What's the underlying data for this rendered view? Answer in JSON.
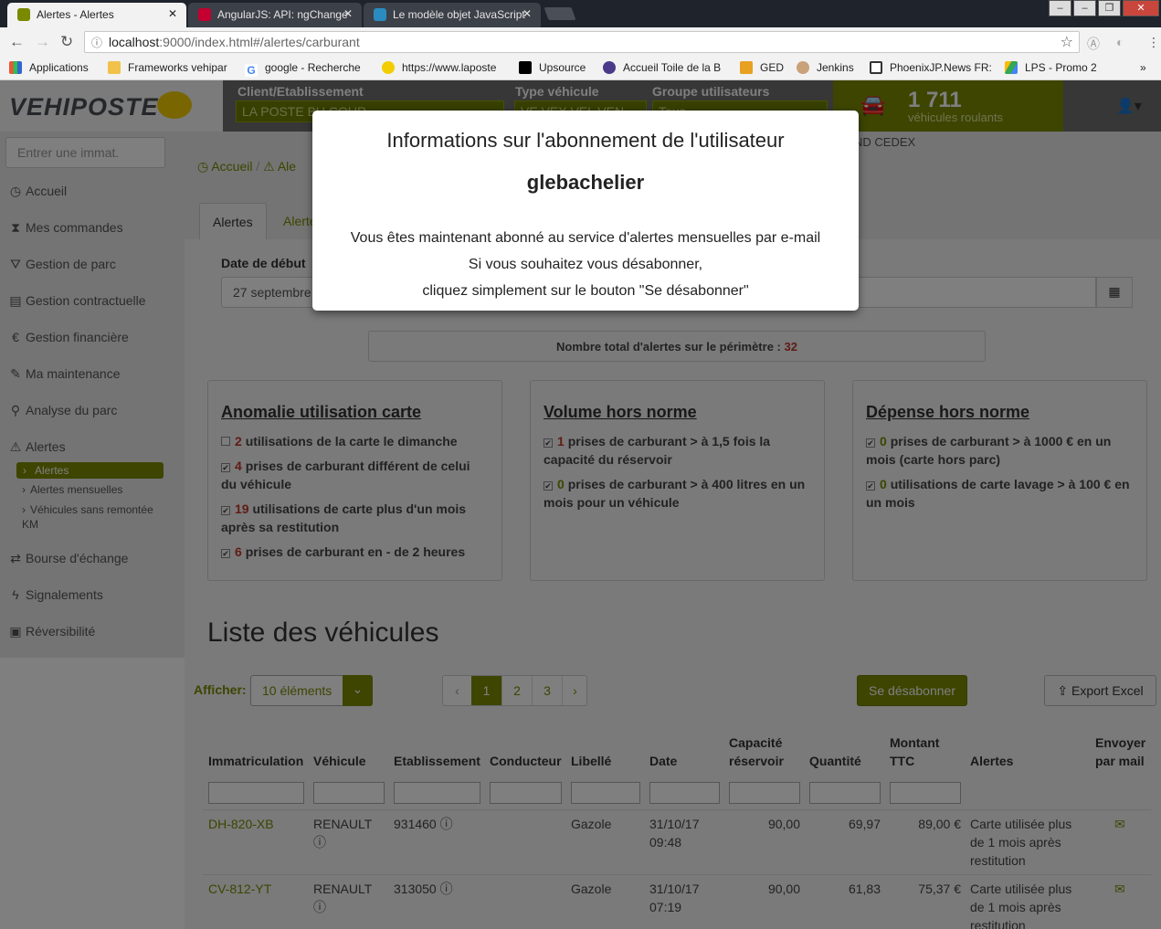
{
  "browser": {
    "tabs": [
      {
        "title": "Alertes - Alertes",
        "close": "✕"
      },
      {
        "title": "AngularJS: API: ngChange",
        "close": "✕"
      },
      {
        "title": "Le modèle objet JavaScript",
        "close": "✕"
      }
    ],
    "url_host": "localhost",
    "url_path": ":9000/index.html#/alertes/carburant",
    "bookmarks": [
      "Applications",
      "Frameworks vehipar",
      "google - Recherche",
      "https://www.laposte",
      "Upsource",
      "Accueil Toile de la B",
      "GED",
      "Jenkins",
      "PhoenixJP.News FR:",
      "LPS - Promo 2"
    ],
    "more": "»"
  },
  "header": {
    "logo_text": "VEHIPOSTE",
    "client_label": "Client/Etablissement",
    "client_value": "LA POSTE BU COUR",
    "type_label": "Type véhicule",
    "type_value": "VE VEX VEL VEN",
    "group_label": "Groupe utilisateurs",
    "group_value": "Tous",
    "fleet_count": "1 711",
    "fleet_label": "véhicules roulants",
    "behind_text": "ND CEDEX"
  },
  "sidebar": {
    "search_placeholder": "Entrer une immat.",
    "items": [
      {
        "label": "Accueil",
        "icon": "◷"
      },
      {
        "label": "Mes commandes",
        "icon": "⧗"
      },
      {
        "label": "Gestion de parc",
        "icon": "⛛"
      },
      {
        "label": "Gestion contractuelle",
        "icon": "▤"
      },
      {
        "label": "Gestion financière",
        "icon": "€"
      },
      {
        "label": "Ma maintenance",
        "icon": "✎"
      },
      {
        "label": "Analyse du parc",
        "icon": "⚲"
      },
      {
        "label": "Alertes",
        "icon": "⚠"
      },
      {
        "label": "Bourse d'échange",
        "icon": "⇄"
      },
      {
        "label": "Signalements",
        "icon": "ϟ"
      },
      {
        "label": "Réversibilité",
        "icon": "▣"
      }
    ],
    "sub_items": [
      "Alertes",
      "Alertes mensuelles",
      "Véhicules sans remontée",
      "KM"
    ]
  },
  "breadcrumb": {
    "home": "Accueil",
    "sep": "/",
    "current": "Ale"
  },
  "tabs": {
    "active": "Alertes",
    "second": "Alerte"
  },
  "filters": {
    "date_label": "Date de début",
    "date_value": "27 septembre"
  },
  "total": {
    "label": "Nombre total d'alertes sur le périmètre :",
    "value": "32"
  },
  "panels": [
    {
      "title": "Anomalie utilisation carte",
      "items": [
        {
          "count": "2",
          "text": "utilisations de la carte le dimanche",
          "checked": false
        },
        {
          "count": "4",
          "text": "prises de carburant différent de celui",
          "text2": "du véhicule",
          "checked": true
        },
        {
          "count": "19",
          "text": "utilisations de carte plus d'un mois",
          "text2": "après sa restitution",
          "checked": true
        },
        {
          "count": "6",
          "text": "prises de carburant en - de 2 heures",
          "checked": true
        }
      ]
    },
    {
      "title": "Volume hors norme",
      "items": [
        {
          "count": "1",
          "text": "prises de carburant > à 1,5 fois la",
          "text2": "capacité du réservoir",
          "checked": true
        },
        {
          "count": "0",
          "text": "prises de carburant > à 400 litres en un",
          "text2": "mois pour un véhicule",
          "checked": true
        }
      ]
    },
    {
      "title": "Dépense hors norme",
      "items": [
        {
          "count": "0",
          "text": "prises de carburant > à 1000 € en un",
          "text2": "mois (carte hors parc)",
          "checked": true
        },
        {
          "count": "0",
          "text": "utilisations de carte lavage > à 100 € en",
          "text2": "un mois",
          "checked": true
        }
      ]
    }
  ],
  "list": {
    "title": "Liste des véhicules",
    "show_label": "Afficher:",
    "show_value": "10 éléments",
    "pages": [
      "‹",
      "1",
      "2",
      "3",
      "›"
    ],
    "unsubscribe": "Se désabonner",
    "export": "Export Excel"
  },
  "table": {
    "headers": [
      "Immatriculation",
      "Véhicule",
      "Etablissement",
      "Conducteur",
      "Libellé",
      "Date",
      "Capacité",
      "réservoir",
      "Quantité",
      "Montant",
      "TTC",
      "Alertes",
      "Envoyer",
      "par mail"
    ],
    "rows": [
      {
        "immat": "DH-820-XB",
        "vehicule": "RENAULT",
        "etab": "931460",
        "conducteur": "",
        "libelle": "Gazole",
        "date1": "31/10/17",
        "date2": "09:48",
        "capacite": "90,00",
        "quantite": "69,97",
        "montant": "89,00 €",
        "alerte1": "Carte utilisée plus",
        "alerte2": "de 1 mois après",
        "alerte3": "restitution"
      },
      {
        "immat": "CV-812-YT",
        "vehicule": "RENAULT",
        "etab": "313050",
        "conducteur": "",
        "libelle": "Gazole",
        "date1": "31/10/17",
        "date2": "07:19",
        "capacite": "90,00",
        "quantite": "61,83",
        "montant": "75,37 €",
        "alerte1": "Carte utilisée plus",
        "alerte2": "de 1 mois après",
        "alerte3": "restitution"
      }
    ]
  },
  "modal": {
    "title": "Informations sur l'abonnement de l'utilisateur",
    "username": "glebachelier",
    "line1": "Vous êtes maintenant abonné au service d'alertes mensuelles par e-mail",
    "line2": "Si vous souhaitez vous désabonner,",
    "line3": "cliquez simplement sur le bouton \"Se désabonner\""
  }
}
